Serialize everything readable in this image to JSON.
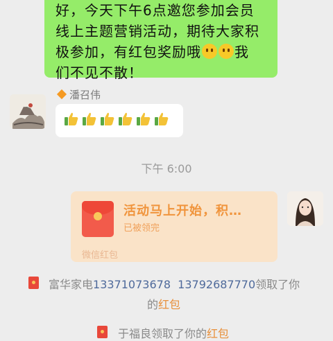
{
  "top_message": {
    "line1": "好，今天下午6点邀您参加会员",
    "line2": "线上主题营销活动，期待大家积",
    "line3": "极参加，有红包奖励哦",
    "line3_end": "我",
    "line4": "们不见不散！"
  },
  "sender": {
    "name": "潘召伟"
  },
  "thumbs_count": 6,
  "time_divider": "下午 6:00",
  "red_packet": {
    "title": "活动马上开始，积…",
    "status": "已被领完",
    "footer": "微信红包"
  },
  "notices": [
    {
      "prefix": "富华家电",
      "phone1": "13371073678",
      "phone2": "13792687770",
      "suffix": "领取了你",
      "line2_pre": "的",
      "link": "红包"
    },
    {
      "text": "于福良领取了你的",
      "link": "红包"
    }
  ],
  "colors": {
    "bubble_green": "#95ec69",
    "packet_bg": "#fae3c8",
    "packet_title": "#f0943c",
    "phone_link": "#4f6a9b",
    "packet_link": "#e8903b",
    "background": "#ededed"
  }
}
